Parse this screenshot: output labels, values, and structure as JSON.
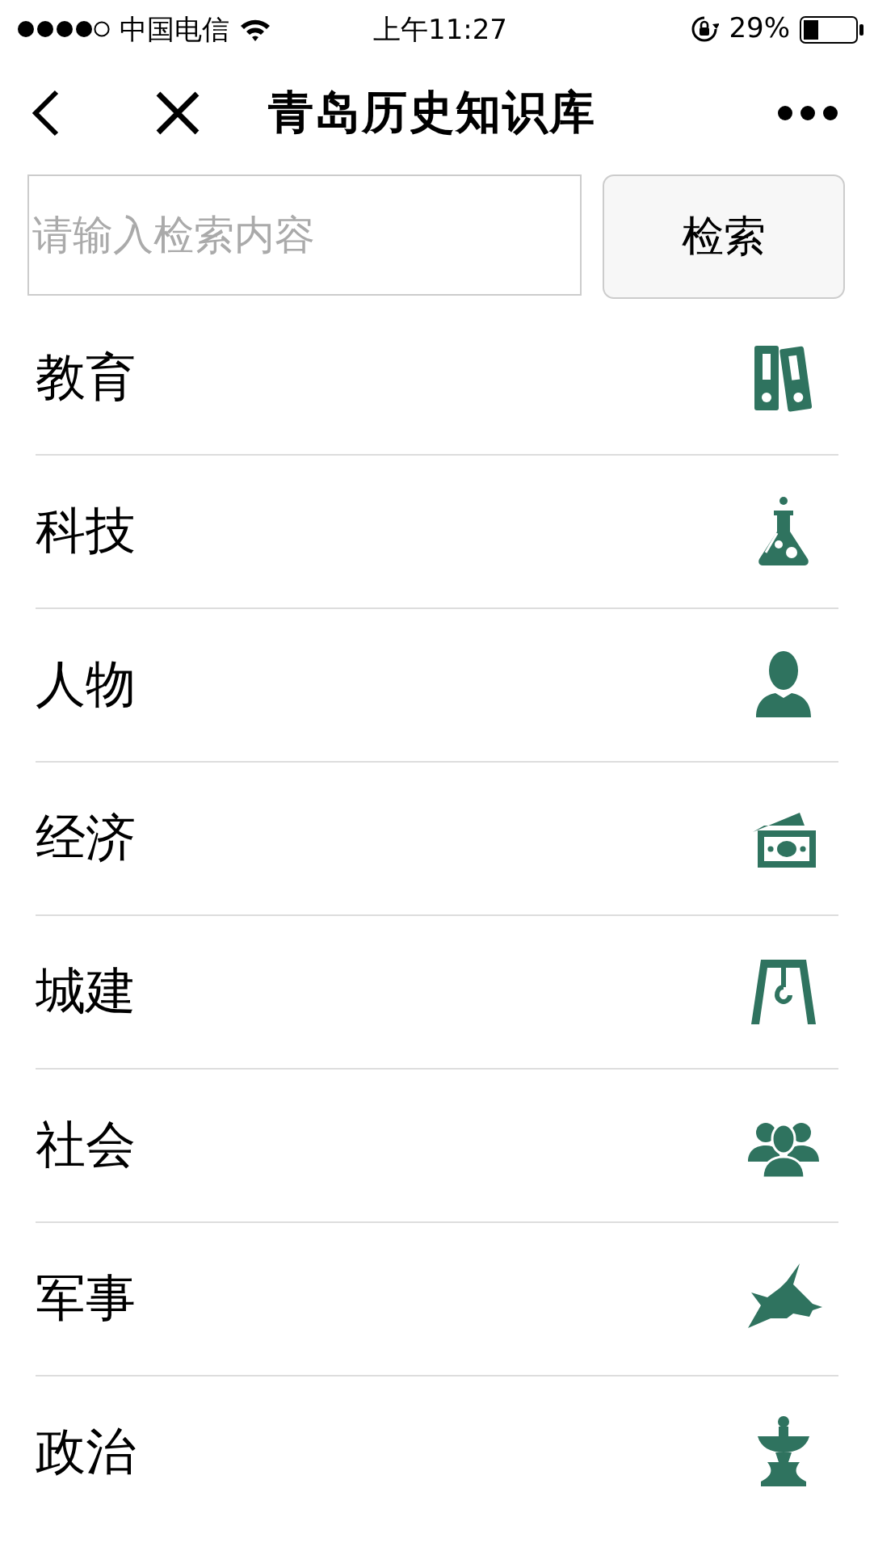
{
  "status_bar": {
    "carrier": "中国电信",
    "time": "上午11:27",
    "battery": "29%"
  },
  "nav": {
    "title": "青岛历史知识库"
  },
  "search": {
    "placeholder": "请输入检索内容",
    "button": "检索"
  },
  "categories": [
    {
      "label": "教育"
    },
    {
      "label": "科技"
    },
    {
      "label": "人物"
    },
    {
      "label": "经济"
    },
    {
      "label": "城建"
    },
    {
      "label": "社会"
    },
    {
      "label": "军事"
    },
    {
      "label": "政治"
    }
  ]
}
